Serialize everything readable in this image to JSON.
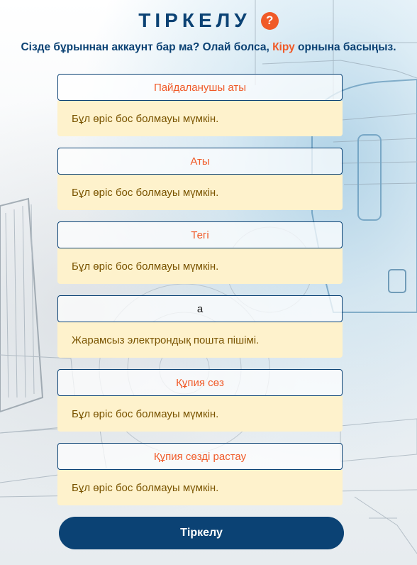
{
  "page": {
    "title": "ТІРКЕЛУ",
    "help_icon": "?",
    "subtitle_before": "Сізде бұрыннан аккаунт бар ма? Олай болса, ",
    "subtitle_link": "Кіру",
    "subtitle_after": " орнына басыңыз."
  },
  "fields": [
    {
      "placeholder": "Пайдаланушы аты",
      "value": "",
      "error": "Бұл өріс бос болмауы мүмкін."
    },
    {
      "placeholder": "Аты",
      "value": "",
      "error": "Бұл өріс бос болмауы мүмкін."
    },
    {
      "placeholder": "Тегі",
      "value": "",
      "error": "Бұл өріс бос болмауы мүмкін."
    },
    {
      "placeholder": "",
      "value": "а",
      "error": "Жарамсыз электрондық пошта пішімі."
    },
    {
      "placeholder": "Құпия сөз",
      "value": "",
      "error": "Бұл өріс бос болмауы мүмкін."
    },
    {
      "placeholder": "Құпия сөзді растау",
      "value": "",
      "error": "Бұл өріс бос болмауы мүмкін."
    }
  ],
  "submit_label": "Тіркелу",
  "colors": {
    "primary": "#0b4274",
    "accent": "#f05a28",
    "error_bg": "#fef2cc",
    "error_text": "#7a5400"
  },
  "icons": {
    "help": "question-circle-icon",
    "background": "truck-blueprint-illustration"
  }
}
